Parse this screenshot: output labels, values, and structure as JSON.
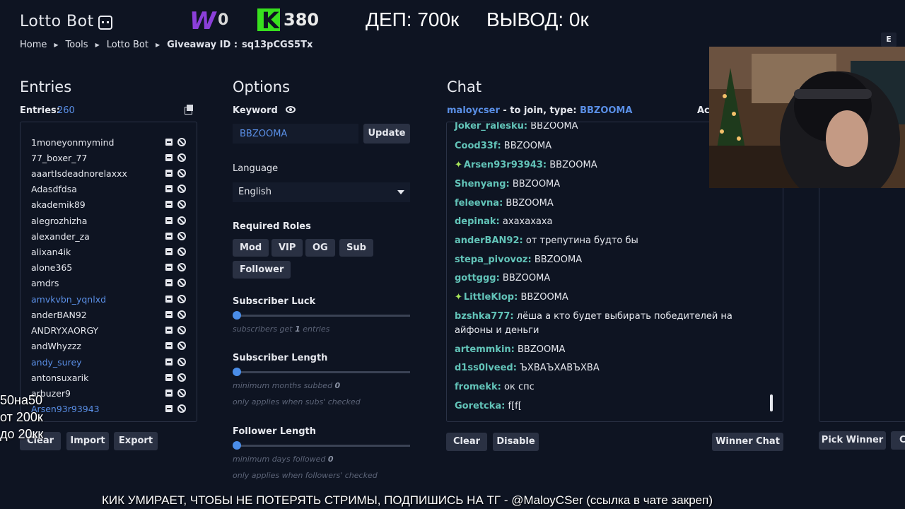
{
  "header": {
    "app_title": "Lotto Bot",
    "w_count": "0",
    "w_logo": "W",
    "k_logo": "K",
    "k_count": "380",
    "dep": "ДЕП: 700к",
    "vyvod": "ВЫВОД: 0к"
  },
  "breadcrumb": {
    "home": "Home",
    "tools": "Tools",
    "lotto": "Lotto Bot",
    "giveaway_label": "Giveaway ID :",
    "giveaway_id": "sq13pCGS5Tx"
  },
  "entries": {
    "heading": "Entries",
    "label": "Entries:",
    "count": "260",
    "items": [
      {
        "name": "1moneyonmymind",
        "highlight": false
      },
      {
        "name": "77_boxer_77",
        "highlight": false
      },
      {
        "name": "aaartIsdeadnorelaxxx",
        "highlight": false
      },
      {
        "name": "Adasdfdsa",
        "highlight": false
      },
      {
        "name": "akademik89",
        "highlight": false
      },
      {
        "name": "alegrozhizha",
        "highlight": false
      },
      {
        "name": "alexander_za",
        "highlight": false
      },
      {
        "name": "alixan4ik",
        "highlight": false
      },
      {
        "name": "alone365",
        "highlight": false
      },
      {
        "name": "amdrs",
        "highlight": false
      },
      {
        "name": "amvkvbn_yqnlxd",
        "highlight": true
      },
      {
        "name": "anderBAN92",
        "highlight": false
      },
      {
        "name": "ANDRYXAORGY",
        "highlight": false
      },
      {
        "name": "andWhyzzz",
        "highlight": false
      },
      {
        "name": "andy_surey",
        "highlight": true
      },
      {
        "name": "antonsuxarik",
        "highlight": false
      },
      {
        "name": "arbuzer9",
        "highlight": false
      },
      {
        "name": "Arsen93r93943",
        "highlight": true
      }
    ],
    "buttons": {
      "clear": "Clear",
      "import": "Import",
      "export": "Export"
    }
  },
  "left_overlay": {
    "line1": "50на50",
    "line2": "от 200к",
    "line3": "до 20кк"
  },
  "options": {
    "heading": "Options",
    "keyword_label": "Keyword",
    "keyword_value": "BBZOOMA",
    "update": "Update",
    "language_label": "Language",
    "language_value": "English",
    "roles_label": "Required Roles",
    "roles": [
      "Mod",
      "VIP",
      "OG",
      "Sub",
      "Follower"
    ],
    "sub_luck_label": "Subscriber Luck",
    "sub_luck_hint_a": "subscribers get",
    "sub_luck_hint_b": "1",
    "sub_luck_hint_c": "entries",
    "sub_length_label": "Subscriber Length",
    "sub_length_hint_a": "minimum months subbed",
    "sub_length_hint_b": "0",
    "sub_length_hint2": "only applies when subs' checked",
    "fol_length_label": "Follower Length",
    "fol_length_hint_a": "minimum days followed",
    "fol_length_hint_b": "0",
    "fol_length_hint2": "only applies when followers' checked",
    "sub_luck_level": 0,
    "sub_length_level": 0,
    "fol_length_level": 0
  },
  "chat": {
    "heading": "Chat",
    "join_user": "maloycser",
    "join_text": " - to join, type: ",
    "join_keyword": "BBZOOMA",
    "ac": "Ac",
    "messages": [
      {
        "nick": "Joker_ralesku:",
        "text": "BBZOOMA",
        "star": false
      },
      {
        "nick": "Cood33f:",
        "text": "BBZOOMA",
        "star": false
      },
      {
        "nick": "Arsen93r93943:",
        "text": "BBZOOMA",
        "star": true
      },
      {
        "nick": "Shenyang:",
        "text": "BBZOOMA",
        "star": false
      },
      {
        "nick": "feleevna:",
        "text": "BBZOOMA",
        "star": false
      },
      {
        "nick": "depinak:",
        "text": "ахахахаха",
        "star": false
      },
      {
        "nick": "anderBAN92:",
        "text": "от трепутина будто бы",
        "star": false
      },
      {
        "nick": "stepa_pivovoz:",
        "text": "BBZOOMA",
        "star": false
      },
      {
        "nick": "gottggg:",
        "text": "BBZOOMA",
        "star": false
      },
      {
        "nick": "LittleKlop:",
        "text": "BBZOOMA",
        "star": true
      },
      {
        "nick": "bzshka777:",
        "text": "лёша а кто будет выбирать победителей на айфоны и деньги",
        "star": false
      },
      {
        "nick": "artemmkin:",
        "text": "BBZOOMA",
        "star": false
      },
      {
        "nick": "d1ss0lveed:",
        "text": "ЪХВАЪХАВЪХВА",
        "star": false
      },
      {
        "nick": "fromekk:",
        "text": "ок спс",
        "star": false
      },
      {
        "nick": "Goretcka:",
        "text": "f[f[",
        "star": false
      }
    ],
    "buttons": {
      "clear": "Clear",
      "disable": "Disable",
      "winner_chat": "Winner Chat"
    }
  },
  "right": {
    "pick_winner": "Pick Winner",
    "c": "C"
  },
  "e_key": "E",
  "banner": "КИК УМИРАЕТ, ЧТОБЫ НЕ ПОТЕРЯТЬ СТРИМЫ, ПОДПИШИСЬ НА ТГ - @MaloyCSer (ссылка в чате закреп)",
  "colors": {
    "background": "#0e1422",
    "accent": "#5a8fe6",
    "nick": "#62c3b8",
    "kick_green": "#38e01e",
    "w_purple": "#8b3fd9"
  }
}
